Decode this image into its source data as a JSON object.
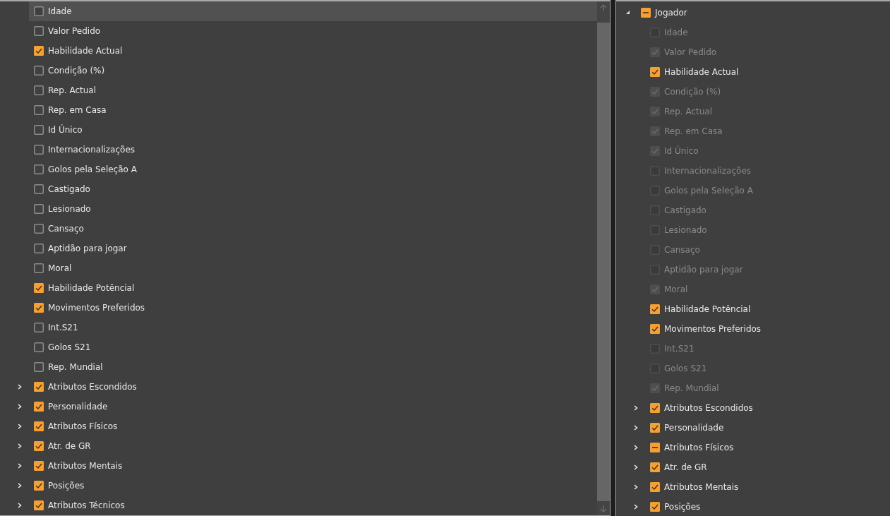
{
  "left_list": {
    "items": [
      {
        "label": "Idade",
        "kind": "field",
        "checked": false,
        "selected": true
      },
      {
        "label": "Valor Pedido",
        "kind": "field",
        "checked": false,
        "selected": false
      },
      {
        "label": "Habilidade Actual",
        "kind": "field",
        "checked": true,
        "selected": false
      },
      {
        "label": "Condição (%)",
        "kind": "field",
        "checked": false,
        "selected": false
      },
      {
        "label": "Rep. Actual",
        "kind": "field",
        "checked": false,
        "selected": false
      },
      {
        "label": "Rep. em Casa",
        "kind": "field",
        "checked": false,
        "selected": false
      },
      {
        "label": "Id Único",
        "kind": "field",
        "checked": false,
        "selected": false
      },
      {
        "label": "Internacionalizações",
        "kind": "field",
        "checked": false,
        "selected": false
      },
      {
        "label": "Golos pela Seleção A",
        "kind": "field",
        "checked": false,
        "selected": false
      },
      {
        "label": "Castigado",
        "kind": "field",
        "checked": false,
        "selected": false
      },
      {
        "label": "Lesionado",
        "kind": "field",
        "checked": false,
        "selected": false
      },
      {
        "label": "Cansaço",
        "kind": "field",
        "checked": false,
        "selected": false
      },
      {
        "label": "Aptidão para jogar",
        "kind": "field",
        "checked": false,
        "selected": false
      },
      {
        "label": "Moral",
        "kind": "field",
        "checked": false,
        "selected": false
      },
      {
        "label": "Habilidade Potêncial",
        "kind": "field",
        "checked": true,
        "selected": false
      },
      {
        "label": "Movimentos Preferidos",
        "kind": "field",
        "checked": true,
        "selected": false
      },
      {
        "label": "Int.S21",
        "kind": "field",
        "checked": false,
        "selected": false
      },
      {
        "label": "Golos S21",
        "kind": "field",
        "checked": false,
        "selected": false
      },
      {
        "label": "Rep. Mundial",
        "kind": "field",
        "checked": false,
        "selected": false
      },
      {
        "label": "Atributos Escondidos",
        "kind": "group",
        "checked": true,
        "selected": false,
        "expanded": false
      },
      {
        "label": "Personalidade",
        "kind": "group",
        "checked": true,
        "selected": false,
        "expanded": false
      },
      {
        "label": "Atributos Físicos",
        "kind": "group",
        "checked": true,
        "selected": false,
        "expanded": false
      },
      {
        "label": "Atr. de GR",
        "kind": "group",
        "checked": true,
        "selected": false,
        "expanded": false
      },
      {
        "label": "Atributos Mentais",
        "kind": "group",
        "checked": true,
        "selected": false,
        "expanded": false
      },
      {
        "label": "Posições",
        "kind": "group",
        "checked": true,
        "selected": false,
        "expanded": false
      },
      {
        "label": "Atributos Técnicos",
        "kind": "group",
        "checked": true,
        "selected": false,
        "expanded": false
      }
    ]
  },
  "right_tree": {
    "root": {
      "label": "Jogador",
      "partial": true,
      "expanded": true,
      "children": [
        {
          "label": "Idade",
          "kind": "field",
          "checked": false,
          "partial": false,
          "disabled": true
        },
        {
          "label": "Valor Pedido",
          "kind": "field",
          "checked": true,
          "partial": false,
          "disabled": true
        },
        {
          "label": "Habilidade Actual",
          "kind": "field",
          "checked": true,
          "partial": false,
          "disabled": false
        },
        {
          "label": "Condição (%)",
          "kind": "field",
          "checked": true,
          "partial": false,
          "disabled": true
        },
        {
          "label": "Rep. Actual",
          "kind": "field",
          "checked": true,
          "partial": false,
          "disabled": true
        },
        {
          "label": "Rep. em Casa",
          "kind": "field",
          "checked": true,
          "partial": false,
          "disabled": true
        },
        {
          "label": "Id Único",
          "kind": "field",
          "checked": true,
          "partial": false,
          "disabled": true
        },
        {
          "label": "Internacionalizações",
          "kind": "field",
          "checked": false,
          "partial": false,
          "disabled": true
        },
        {
          "label": "Golos pela Seleção A",
          "kind": "field",
          "checked": false,
          "partial": false,
          "disabled": true
        },
        {
          "label": "Castigado",
          "kind": "field",
          "checked": false,
          "partial": false,
          "disabled": true
        },
        {
          "label": "Lesionado",
          "kind": "field",
          "checked": false,
          "partial": false,
          "disabled": true
        },
        {
          "label": "Cansaço",
          "kind": "field",
          "checked": false,
          "partial": false,
          "disabled": true
        },
        {
          "label": "Aptidão para jogar",
          "kind": "field",
          "checked": false,
          "partial": false,
          "disabled": true
        },
        {
          "label": "Moral",
          "kind": "field",
          "checked": true,
          "partial": false,
          "disabled": true
        },
        {
          "label": "Habilidade Potêncial",
          "kind": "field",
          "checked": true,
          "partial": false,
          "disabled": false
        },
        {
          "label": "Movimentos Preferidos",
          "kind": "field",
          "checked": true,
          "partial": false,
          "disabled": false
        },
        {
          "label": "Int.S21",
          "kind": "field",
          "checked": false,
          "partial": false,
          "disabled": true
        },
        {
          "label": "Golos S21",
          "kind": "field",
          "checked": false,
          "partial": false,
          "disabled": true
        },
        {
          "label": "Rep. Mundial",
          "kind": "field",
          "checked": true,
          "partial": false,
          "disabled": true
        },
        {
          "label": "Atributos Escondidos",
          "kind": "group",
          "checked": true,
          "partial": false,
          "disabled": false,
          "expanded": false
        },
        {
          "label": "Personalidade",
          "kind": "group",
          "checked": true,
          "partial": false,
          "disabled": false,
          "expanded": false
        },
        {
          "label": "Atributos Físicos",
          "kind": "group",
          "checked": true,
          "partial": true,
          "disabled": false,
          "expanded": false
        },
        {
          "label": "Atr. de GR",
          "kind": "group",
          "checked": true,
          "partial": false,
          "disabled": false,
          "expanded": false
        },
        {
          "label": "Atributos Mentais",
          "kind": "group",
          "checked": true,
          "partial": false,
          "disabled": false,
          "expanded": false
        },
        {
          "label": "Posições",
          "kind": "group",
          "checked": true,
          "partial": false,
          "disabled": false,
          "expanded": false
        }
      ]
    }
  }
}
